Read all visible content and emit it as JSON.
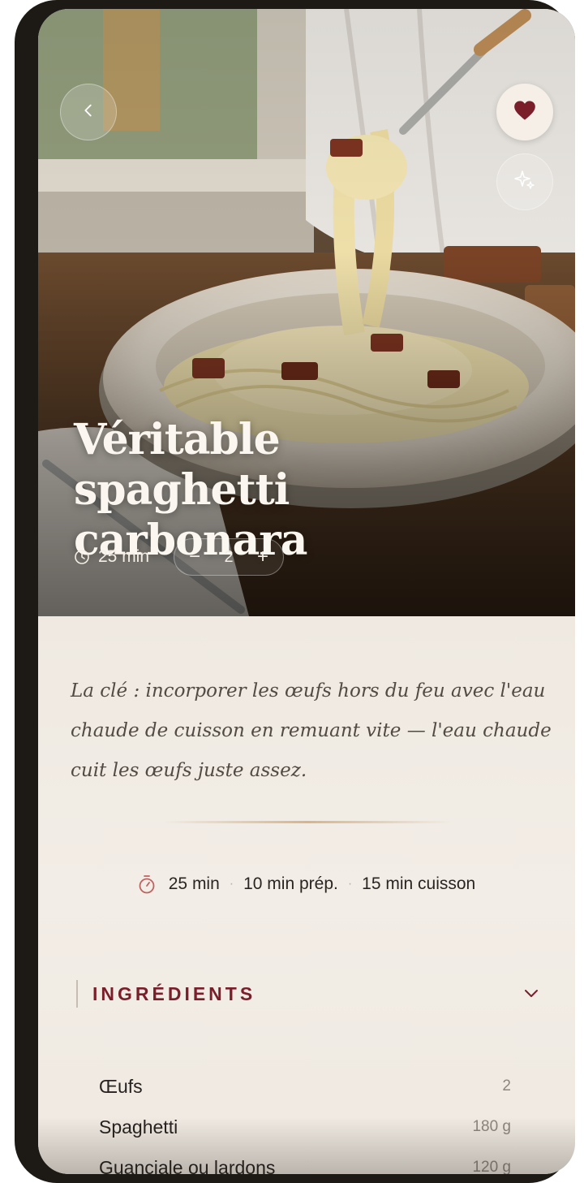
{
  "hero": {
    "title": "Véritable spaghetti carbonara",
    "time": "25 min",
    "servings": "2",
    "favorite_color": "#7a1f2a"
  },
  "buttons": {
    "back_icon": "chevron-left-icon",
    "favorite_icon": "heart-icon",
    "ai_icon": "sparkles-icon",
    "minus_label": "−",
    "plus_label": "+"
  },
  "tip": "La clé : incorporer les œufs hors du feu avec l'eau chaude de cuisson en remuant vite — l'eau chaude cuit les œufs juste assez.",
  "times": {
    "total": "25 min",
    "prep": "10 min prép.",
    "cook": "15 min cuisson"
  },
  "ingredients": {
    "title": "INGRÉDIENTS",
    "accent": "#7a1f2a",
    "items": [
      {
        "name": "Œufs",
        "qty": "2"
      },
      {
        "name": "Spaghetti",
        "qty": "180 g"
      },
      {
        "name": "Guanciale ou lardons",
        "qty": "120 g"
      }
    ]
  }
}
